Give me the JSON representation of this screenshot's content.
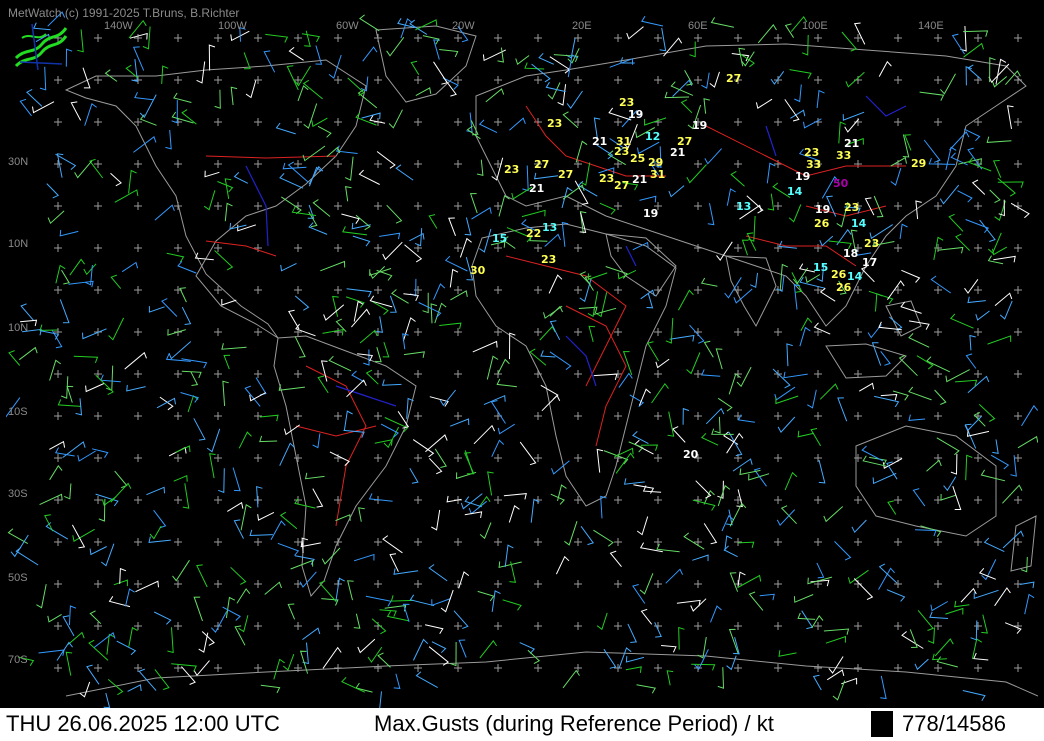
{
  "app": {
    "credit": "MetWatch  (c) 1991-2025 T.Bruns, B.Richter"
  },
  "axes": {
    "lon_labels": [
      "140W",
      "100W",
      "60W",
      "20W",
      "20E",
      "60E",
      "100E",
      "140E"
    ],
    "lat_labels": [
      "30N",
      "10N",
      "10N",
      "10S",
      "30S",
      "50S",
      "70S"
    ]
  },
  "gusts": [
    {
      "value": "27",
      "color": "#ffff55"
    },
    {
      "value": "23",
      "color": "#ffff55"
    },
    {
      "value": "19",
      "color": "#ffffff"
    },
    {
      "value": "23",
      "color": "#ffff55"
    },
    {
      "value": "19",
      "color": "#ffffff"
    },
    {
      "value": "12",
      "color": "#55ffff"
    },
    {
      "value": "21",
      "color": "#ffffff"
    },
    {
      "value": "31",
      "color": "#ffff55"
    },
    {
      "value": "27",
      "color": "#ffff55"
    },
    {
      "value": "23",
      "color": "#ffff55"
    },
    {
      "value": "25",
      "color": "#ffff55"
    },
    {
      "value": "21",
      "color": "#ffffff"
    },
    {
      "value": "29",
      "color": "#ffff55"
    },
    {
      "value": "27",
      "color": "#ffff55"
    },
    {
      "value": "23",
      "color": "#ffff55"
    },
    {
      "value": "27",
      "color": "#ffff55"
    },
    {
      "value": "31",
      "color": "#ffff55"
    },
    {
      "value": "23",
      "color": "#ffff55"
    },
    {
      "value": "21",
      "color": "#ffffff"
    },
    {
      "value": "27",
      "color": "#ffff55"
    },
    {
      "value": "21",
      "color": "#ffffff"
    },
    {
      "value": "19",
      "color": "#ffffff"
    },
    {
      "value": "13",
      "color": "#55ffff"
    },
    {
      "value": "15",
      "color": "#55ffff"
    },
    {
      "value": "22",
      "color": "#ffff55"
    },
    {
      "value": "23",
      "color": "#ffff55"
    },
    {
      "value": "30",
      "color": "#ffff55"
    },
    {
      "value": "13",
      "color": "#55ffff"
    },
    {
      "value": "21",
      "color": "#ffffff"
    },
    {
      "value": "23",
      "color": "#ffff55"
    },
    {
      "value": "33",
      "color": "#ffff55"
    },
    {
      "value": "33",
      "color": "#ffff55"
    },
    {
      "value": "19",
      "color": "#ffffff"
    },
    {
      "value": "14",
      "color": "#55ffff"
    },
    {
      "value": "50",
      "color": "#aa00aa"
    },
    {
      "value": "29",
      "color": "#ffff55"
    },
    {
      "value": "19",
      "color": "#ffffff"
    },
    {
      "value": "23",
      "color": "#ffff55"
    },
    {
      "value": "26",
      "color": "#ffff55"
    },
    {
      "value": "14",
      "color": "#55ffff"
    },
    {
      "value": "23",
      "color": "#ffff55"
    },
    {
      "value": "18",
      "color": "#ffffff"
    },
    {
      "value": "17",
      "color": "#ffffff"
    },
    {
      "value": "15",
      "color": "#55ffff"
    },
    {
      "value": "26",
      "color": "#ffff55"
    },
    {
      "value": "14",
      "color": "#55ffff"
    },
    {
      "value": "26",
      "color": "#ffff55"
    },
    {
      "value": "20",
      "color": "#ffffff"
    }
  ],
  "footer": {
    "datetime": "THU 26.06.2025 12:00 UTC",
    "parameter": "Max.Gusts (during Reference Period) / kt",
    "counts": "778/14586"
  },
  "colors": {
    "background": "#000000",
    "grid": "#9a9a9a",
    "coastline": "#9a9a9a",
    "borders": "#dd2222",
    "rivers": "#2222cc",
    "barb_colors": [
      "#22cc22",
      "#3399ff",
      "#ffffff",
      "#44aaff",
      "#66dd66"
    ]
  }
}
